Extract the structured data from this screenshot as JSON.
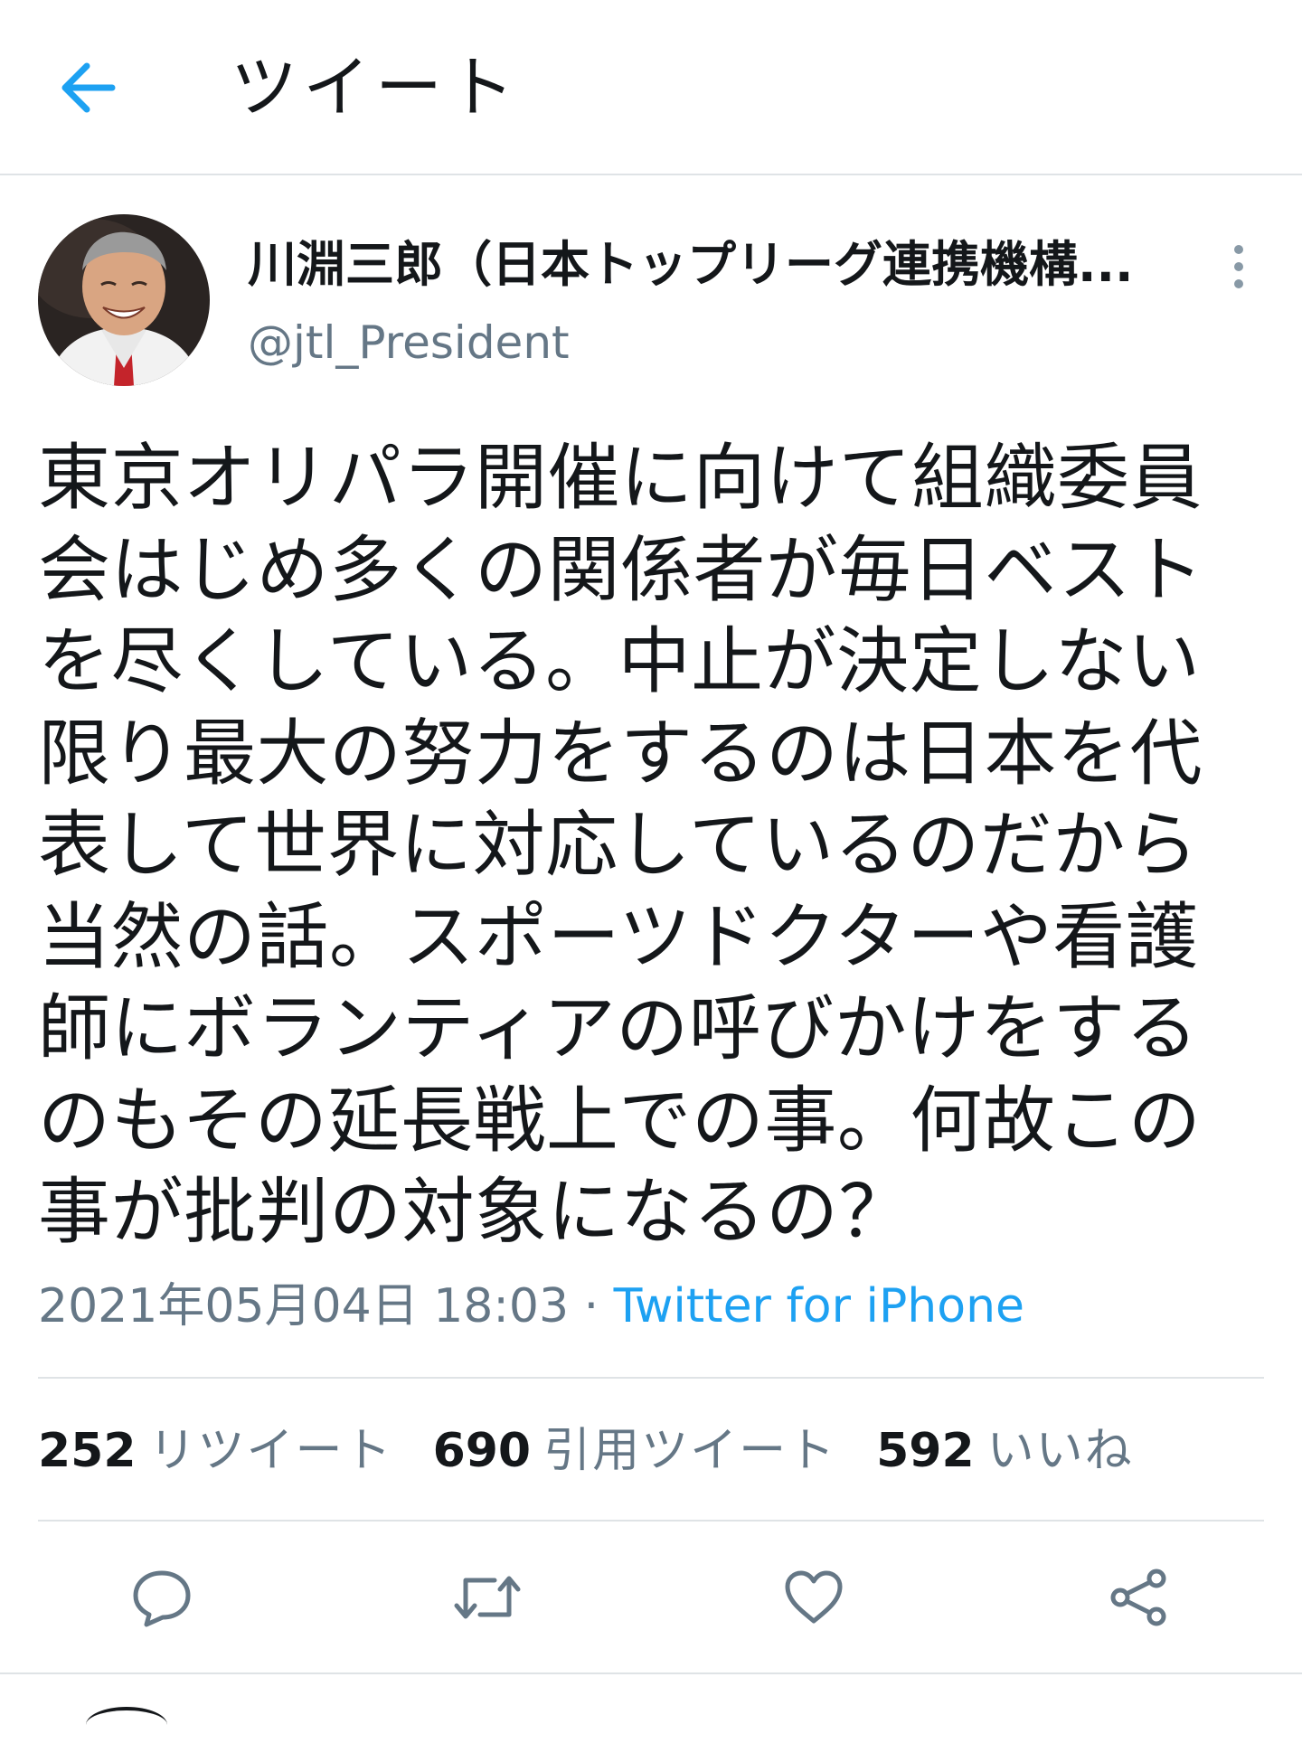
{
  "header": {
    "back_icon": "arrow-left-icon",
    "title": "ツイート"
  },
  "tweet": {
    "author": {
      "display_name": "川淵三郎（日本トップリーグ連携機構...",
      "handle": "@jtl_President"
    },
    "text": "東京オリパラ開催に向けて組織委員会はじめ多くの関係者が毎日ベストを尽くしている。中止が決定しない限り最大の努力をするのは日本を代表して世界に対応しているのだから当然の話。スポーツドクターや看護師にボランティアの呼びかけをするのもその延長戦上での事。何故この事が批判の対象になるの？",
    "datetime": "2021年05月04日 18:03",
    "separator": " · ",
    "source": "Twitter for iPhone",
    "stats": {
      "retweets": {
        "count": "252",
        "label": "リツイート"
      },
      "quotes": {
        "count": "690",
        "label": "引用ツイート"
      },
      "likes": {
        "count": "592",
        "label": "いいね"
      }
    },
    "actions": [
      "reply-icon",
      "retweet-icon",
      "like-icon",
      "share-icon"
    ]
  },
  "colors": {
    "accent": "#1da1f2",
    "secondary_text": "#657786",
    "primary_text": "#14171a",
    "divider": "#dfe3e6",
    "icon": "#657786"
  }
}
